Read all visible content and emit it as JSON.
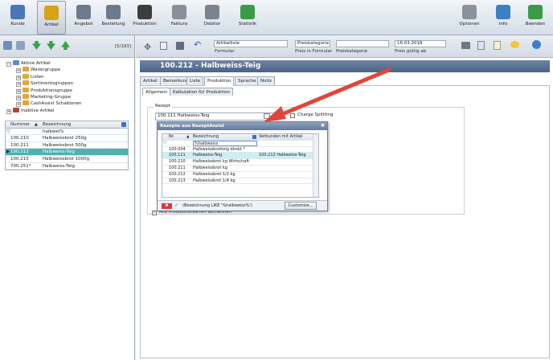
{
  "ribbon": {
    "items": [
      {
        "label": "Kunde",
        "icon": "person-icon",
        "color": "#4a76b5"
      },
      {
        "label": "Artikel",
        "icon": "coins-icon",
        "color": "#d4a318"
      },
      {
        "label": "Angebot",
        "icon": "document-icon",
        "color": "#6b7a8c"
      },
      {
        "label": "Bestellung",
        "icon": "document-edit-icon",
        "color": "#6b7a8c"
      },
      {
        "label": "Produktion",
        "icon": "film-icon",
        "color": "#3d3d3d"
      },
      {
        "label": "Faktura",
        "icon": "pen-icon",
        "color": "#8a8f99"
      },
      {
        "label": "Debitor",
        "icon": "safe-icon",
        "color": "#7b8390"
      },
      {
        "label": "Statistik",
        "icon": "chart-icon",
        "color": "#3b9a48"
      },
      {
        "label": "Optionen",
        "icon": "gear-icon",
        "color": "#8a939d"
      },
      {
        "label": "Info",
        "icon": "info-icon",
        "color": "#3d7fc4"
      },
      {
        "label": "Beenden",
        "icon": "exit-icon",
        "color": "#3b9a48"
      }
    ]
  },
  "left": {
    "count": "[5/193]",
    "tree": [
      {
        "label": "Aktive Artikel",
        "level": 0,
        "toggle": "−"
      },
      {
        "label": "Warengruppe",
        "level": 1,
        "toggle": "+"
      },
      {
        "label": "Listen",
        "level": 1,
        "toggle": "+"
      },
      {
        "label": "Sortimentsgruppen",
        "level": 1,
        "toggle": "+"
      },
      {
        "label": "Produktionsgruppe",
        "level": 1,
        "toggle": "+"
      },
      {
        "label": "Marketing-Gruppe",
        "level": 1,
        "toggle": "+"
      },
      {
        "label": "CashAssist Schablonen",
        "level": 1,
        "toggle": "+"
      },
      {
        "label": "Inaktive Artikel",
        "level": 0,
        "toggle": "+"
      }
    ],
    "grid": {
      "col_nummer": "Nummer",
      "col_bez": "Bezeichnung",
      "filter": "halbwei%",
      "rows": [
        {
          "nummer": "100.210",
          "bez": "Halbweissbrot 250g"
        },
        {
          "nummer": "100.211",
          "bez": "Halbweissbrot 500g"
        },
        {
          "nummer": "100.212",
          "bez": "Halbweiss-Teig",
          "selected": true
        },
        {
          "nummer": "100.215",
          "bez": "Halbweissbrot 1000g"
        },
        {
          "nummer": "700.251*",
          "bez": "Halbweiss-Teig"
        }
      ]
    }
  },
  "toolbar": {
    "artikelliste": "Artikelliste",
    "formular_label": "Formular",
    "preiskategorie": "Preiskategorie",
    "preis_formular_label": "Preis in Formular",
    "preiskategorie_label": "Preiskategorie",
    "date": "16.03.2018",
    "date_label": "Preis gültig ab"
  },
  "detail": {
    "title": "100.212 - Halbweiss-Teig",
    "tabs": [
      "Artikel",
      "Bemerkung",
      "Liste",
      "Produktion",
      "Sprache",
      "Notiz"
    ],
    "subtabs": [
      "Allgemein",
      "Kalkulation für Produktion"
    ],
    "rezept_label": "Rezept",
    "rezept_value": "100.111  Halbweiss-Teig",
    "charge_label": "Charge Splitting",
    "bottom_check": "Alle Produktionsarten abmahnen"
  },
  "popup": {
    "title": "Rezepte aus RezeptAssist",
    "col_nr": "Nr.",
    "col_bez": "Bezeichnung",
    "col_verb": "Verbunden mit Artikel",
    "filter": "%halbweiss",
    "rows": [
      {
        "nr": "100.004",
        "bez": "Halbweissbrotteig direkt *",
        "verb": ""
      },
      {
        "nr": "100.111",
        "bez": "Halbweiss-Teig",
        "verb": "100.212  Halbweiss-Teig",
        "selected": true
      },
      {
        "nr": "100.210",
        "bez": "Halbweissbrot kg Wirtschaft",
        "verb": ""
      },
      {
        "nr": "100.211",
        "bez": "Halbweissbrot kg",
        "verb": ""
      },
      {
        "nr": "100.212",
        "bez": "Halbweissbrot 1/2 kg",
        "verb": ""
      },
      {
        "nr": "100.213",
        "bez": "Halbweissbrot 1/4 kg",
        "verb": ""
      }
    ],
    "filter_expr": "(Bezeichnung LIKE '%halbweiss%')",
    "customize": "Customize..."
  }
}
